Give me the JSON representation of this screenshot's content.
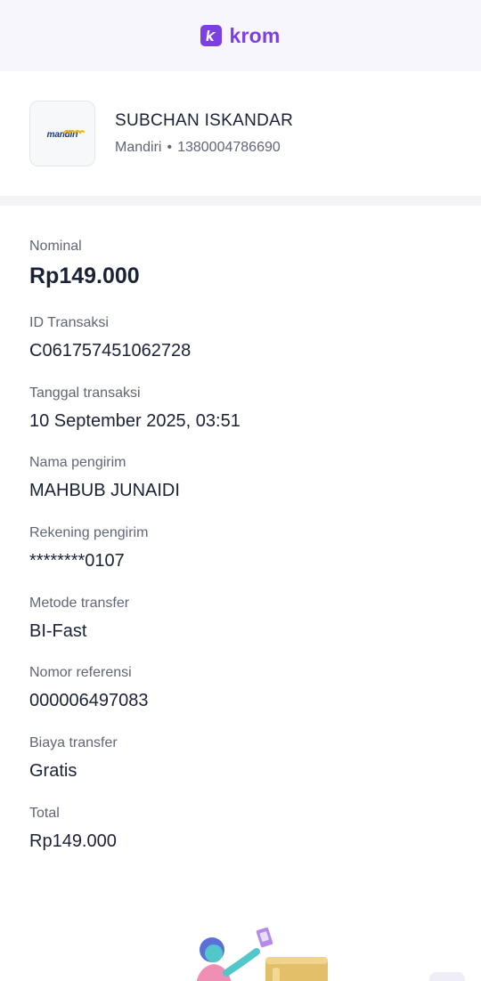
{
  "app": {
    "brand": "krom",
    "brand_color": "#7b3fe4"
  },
  "recipient": {
    "bank_logo_text": "mandiri",
    "name": "SUBCHAN ISKANDAR",
    "bank": "Mandiri",
    "separator": "•",
    "account": "1380004786690"
  },
  "details": [
    {
      "label": "Nominal",
      "value": "Rp149.000"
    },
    {
      "label": "ID Transaksi",
      "value": "C061757451062728"
    },
    {
      "label": "Tanggal transaksi",
      "value": "10 September 2025, 03:51"
    },
    {
      "label": "Nama pengirim",
      "value": "MAHBUB JUNAIDI"
    },
    {
      "label": "Rekening pengirim",
      "value": "********0107"
    },
    {
      "label": "Metode transfer",
      "value": "BI-Fast"
    },
    {
      "label": "Nomor referensi",
      "value": "000006497083"
    },
    {
      "label": "Biaya transfer",
      "value": "Gratis"
    },
    {
      "label": "Total",
      "value": "Rp149.000"
    }
  ]
}
